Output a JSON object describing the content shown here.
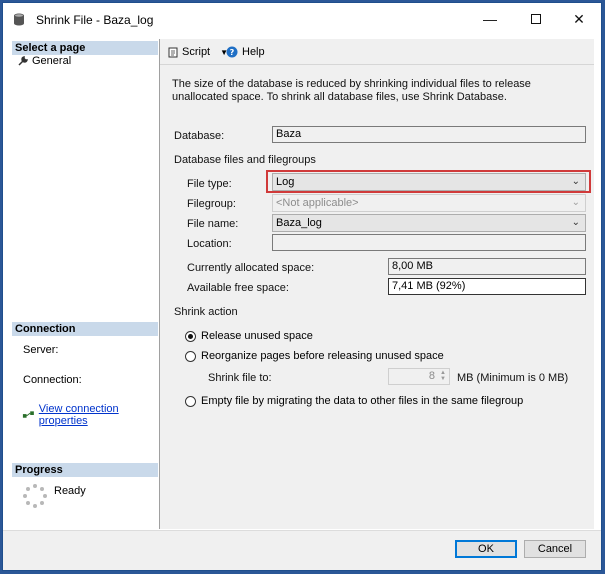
{
  "window": {
    "title": "Shrink File - Baza_log"
  },
  "left": {
    "select_page_header": "Select a page",
    "pages": [
      {
        "label": "General",
        "icon": "wrench-icon"
      }
    ],
    "connection_header": "Connection",
    "server_label": "Server:",
    "connection_label": "Connection:",
    "view_connection_link": "View connection properties",
    "progress_header": "Progress",
    "progress_status": "Ready"
  },
  "toolbar": {
    "script_label": "Script",
    "help_label": "Help"
  },
  "main": {
    "description": "The size of the database is reduced by shrinking individual files to release unallocated space. To shrink all database files, use Shrink Database.",
    "database_label": "Database:",
    "database_value": "Baza",
    "files_group_title": "Database files and filegroups",
    "file_type_label": "File type:",
    "file_type_value": "Log",
    "filegroup_label": "Filegroup:",
    "filegroup_value": "<Not applicable>",
    "file_name_label": "File name:",
    "file_name_value": "Baza_log",
    "location_label": "Location:",
    "location_value": "",
    "allocated_label": "Currently allocated space:",
    "allocated_value": "8,00 MB",
    "free_label": "Available free space:",
    "free_value": "7,41 MB (92%)",
    "shrink_action_title": "Shrink action",
    "option_release": "Release unused space",
    "option_reorganize": "Reorganize pages before releasing unused space",
    "shrink_to_label": "Shrink file to:",
    "shrink_to_value": "8",
    "shrink_to_unit": "MB (Minimum is 0 MB)",
    "option_empty": "Empty file by migrating the data to other files in the same filegroup",
    "selected_option": "Release unused space"
  },
  "footer": {
    "ok_label": "OK",
    "cancel_label": "Cancel"
  },
  "colors": {
    "accent": "#0078d7",
    "highlight": "#d03a3a",
    "section_header": "#c9d9ea"
  }
}
